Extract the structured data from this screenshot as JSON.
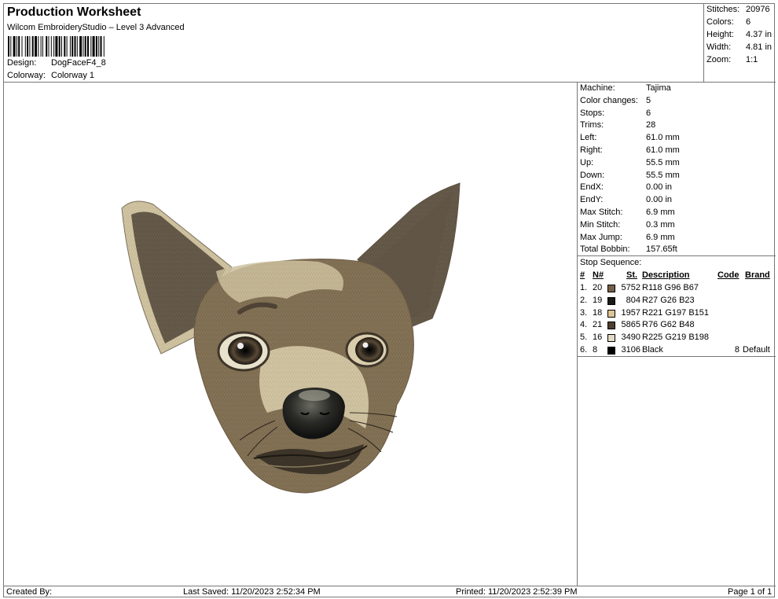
{
  "header": {
    "title": "Production Worksheet",
    "subtitle": "Wilcom EmbroideryStudio – Level 3 Advanced",
    "design_label": "Design:",
    "design_value": "DogFaceF4_8",
    "colorway_label": "Colorway:",
    "colorway_value": "Colorway 1"
  },
  "stats": {
    "stitches_label": "Stitches:",
    "stitches_value": "20976",
    "colors_label": "Colors:",
    "colors_value": "6",
    "height_label": "Height:",
    "height_value": "4.37 in",
    "width_label": "Width:",
    "width_value": "4.81 in",
    "zoom_label": "Zoom:",
    "zoom_value": "1:1"
  },
  "info": [
    {
      "label": "Machine:",
      "value": "Tajima"
    },
    {
      "label": "Color changes:",
      "value": "5"
    },
    {
      "label": "Stops:",
      "value": "6"
    },
    {
      "label": "Trims:",
      "value": "28"
    },
    {
      "label": "Left:",
      "value": "61.0 mm"
    },
    {
      "label": "Right:",
      "value": "61.0 mm"
    },
    {
      "label": "Up:",
      "value": "55.5 mm"
    },
    {
      "label": "Down:",
      "value": "55.5 mm"
    },
    {
      "label": "EndX:",
      "value": "0.00 in"
    },
    {
      "label": "EndY:",
      "value": "0.00 in"
    },
    {
      "label": "Max Stitch:",
      "value": "6.9 mm"
    },
    {
      "label": "Min Stitch:",
      "value": "0.3 mm"
    },
    {
      "label": "Max Jump:",
      "value": "6.9 mm"
    },
    {
      "label": "Total Bobbin:",
      "value": "157.65ft"
    }
  ],
  "stop_sequence": {
    "title": "Stop Sequence:",
    "headers": {
      "num": "#",
      "n": "N#",
      "st": "St.",
      "desc": "Description",
      "code": "Code",
      "brand": "Brand"
    },
    "rows": [
      {
        "num": "1.",
        "n": "20",
        "color": "#76604A",
        "st": "5752",
        "desc": "R118 G96 B67",
        "code": "",
        "brand": ""
      },
      {
        "num": "2.",
        "n": "19",
        "color": "#1B1A17",
        "st": "804",
        "desc": "R27 G26 B23",
        "code": "",
        "brand": ""
      },
      {
        "num": "3.",
        "n": "18",
        "color": "#DDC597",
        "st": "1957",
        "desc": "R221 G197 B151",
        "code": "",
        "brand": ""
      },
      {
        "num": "4.",
        "n": "21",
        "color": "#4C3E30",
        "st": "5865",
        "desc": "R76 G62 B48",
        "code": "",
        "brand": ""
      },
      {
        "num": "5.",
        "n": "16",
        "color": "#E1DBC6",
        "st": "3490",
        "desc": "R225 G219 B198",
        "code": "",
        "brand": ""
      },
      {
        "num": "6.",
        "n": "8",
        "color": "#000000",
        "st": "3106",
        "desc": "Black",
        "code": "8",
        "brand": "Default"
      }
    ]
  },
  "footer": {
    "created_by": "Created By:",
    "last_saved": "Last Saved: 11/20/2023 2:52:34 PM",
    "printed": "Printed: 11/20/2023 2:52:39 PM",
    "page": "Page 1 of 1"
  }
}
